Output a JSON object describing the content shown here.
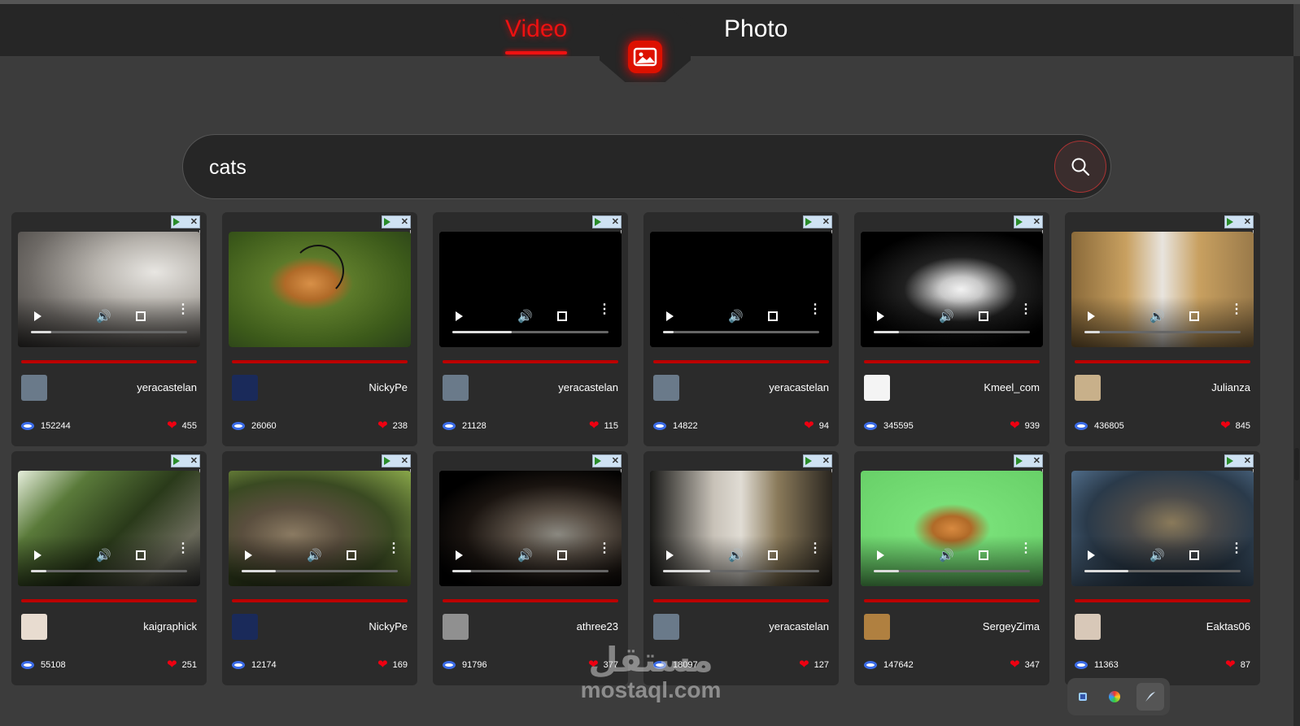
{
  "nav": {
    "tabs": [
      {
        "label": "Video",
        "active": true
      },
      {
        "label": "Photo",
        "active": false
      }
    ],
    "center_icon": "image-icon",
    "accent_color": "#ee1111"
  },
  "search": {
    "value": "cats",
    "button_icon": "search-icon"
  },
  "cards": [
    {
      "username": "yeracastelan",
      "views": "152244",
      "likes": "455",
      "progress": 0.13,
      "theme": "gray-cat"
    },
    {
      "username": "NickyPe",
      "views": "26060",
      "likes": "238",
      "progress": 0,
      "theme": "orange-cat-grass"
    },
    {
      "username": "yeracastelan",
      "views": "21128",
      "likes": "115",
      "progress": 0.38,
      "theme": "black"
    },
    {
      "username": "yeracastelan",
      "views": "14822",
      "likes": "94",
      "progress": 0.07,
      "theme": "black"
    },
    {
      "username": "Kmeel_com",
      "views": "345595",
      "likes": "939",
      "progress": 0.16,
      "theme": "bw-cat"
    },
    {
      "username": "Julianza",
      "views": "436805",
      "likes": "845",
      "progress": 0.1,
      "theme": "white-cat-red"
    },
    {
      "username": "kaigraphick",
      "views": "55108",
      "likes": "251",
      "progress": 0.1,
      "theme": "bench-garden"
    },
    {
      "username": "NickyPe",
      "views": "12174",
      "likes": "169",
      "progress": 0.22,
      "theme": "tabby-green"
    },
    {
      "username": "athree23",
      "views": "91796",
      "likes": "377",
      "progress": 0.12,
      "theme": "dark-cat"
    },
    {
      "username": "yeracastelan",
      "views": "18097",
      "likes": "127",
      "progress": 0.3,
      "theme": "white-cat-dark"
    },
    {
      "username": "SergeyZima",
      "views": "147642",
      "likes": "347",
      "progress": 0.16,
      "theme": "green-screen-cat"
    },
    {
      "username": "Eaktas06",
      "views": "11363",
      "likes": "87",
      "progress": 0.28,
      "theme": "leopard"
    }
  ],
  "watermark": {
    "arabic": "مستقل",
    "latin": "mostaql.com"
  }
}
